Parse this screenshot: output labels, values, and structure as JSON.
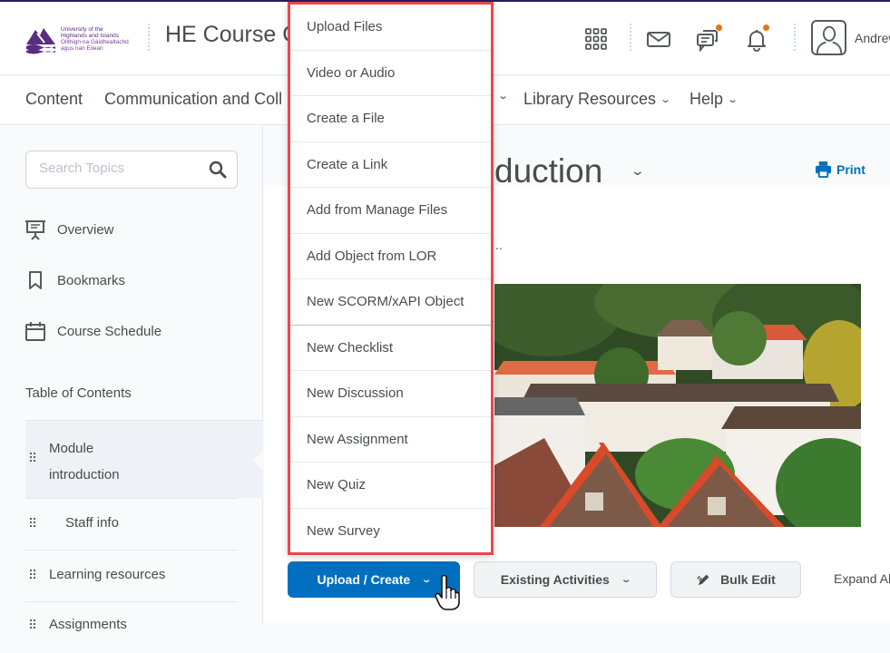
{
  "header": {
    "logo": {
      "lines": [
        "University of the",
        "Highlands and Islands",
        "Oilthigh na Gàidhealtachd",
        "agus nan Eilean"
      ],
      "brand_color": "#5a2d82"
    },
    "course_title": "HE Course C",
    "icons": [
      "apps-grid-icon",
      "mail-icon",
      "chat-icon",
      "bell-icon"
    ],
    "notification_badge_color": "#e87511",
    "user_name": "Andrew"
  },
  "nav": {
    "items": [
      {
        "label": "Content",
        "has_dropdown": false
      },
      {
        "label": "Communication and Coll",
        "has_dropdown": false
      },
      {
        "label": "",
        "has_dropdown": true
      },
      {
        "label": "Library Resources",
        "has_dropdown": true
      },
      {
        "label": "Help",
        "has_dropdown": true
      }
    ],
    "chevron": "⌄"
  },
  "sidebar": {
    "search_placeholder": "Search Topics",
    "links": [
      {
        "label": "Overview",
        "icon": "presentation-icon"
      },
      {
        "label": "Bookmarks",
        "icon": "bookmark-icon"
      },
      {
        "label": "Course Schedule",
        "icon": "calendar-icon"
      }
    ],
    "toc_title": "Table of Contents",
    "toc_items": [
      {
        "label_line1": "Module",
        "label_line2": "introduction",
        "active": true
      },
      {
        "label_line1": "Staff info",
        "active": false,
        "indented": true
      },
      {
        "label_line1": "Learning resources",
        "active": false
      },
      {
        "label_line1": "Assignments",
        "active": false
      }
    ]
  },
  "main": {
    "title_visible": "duction",
    "title_chevron": "⌄",
    "print_label": "Print",
    "accent_color": "#006fbf",
    "dots_text": "..",
    "banner_alt": "Hillside town with colourful houses and trees"
  },
  "toolbar": {
    "upload_create_label": "Upload / Create",
    "existing_activities_label": "Existing Activities",
    "bulk_edit_label": "Bulk Edit",
    "expand_all_label": "Expand Al",
    "chevron": "⌄"
  },
  "dropdown": {
    "highlight_color": "#e8484e",
    "items": [
      "Upload Files",
      "Video or Audio",
      "Create a File",
      "Create a Link",
      "Add from Manage Files",
      "Add Object from LOR",
      "New SCORM/xAPI Object",
      "New Checklist",
      "New Discussion",
      "New Assignment",
      "New Quiz",
      "New Survey"
    ]
  }
}
